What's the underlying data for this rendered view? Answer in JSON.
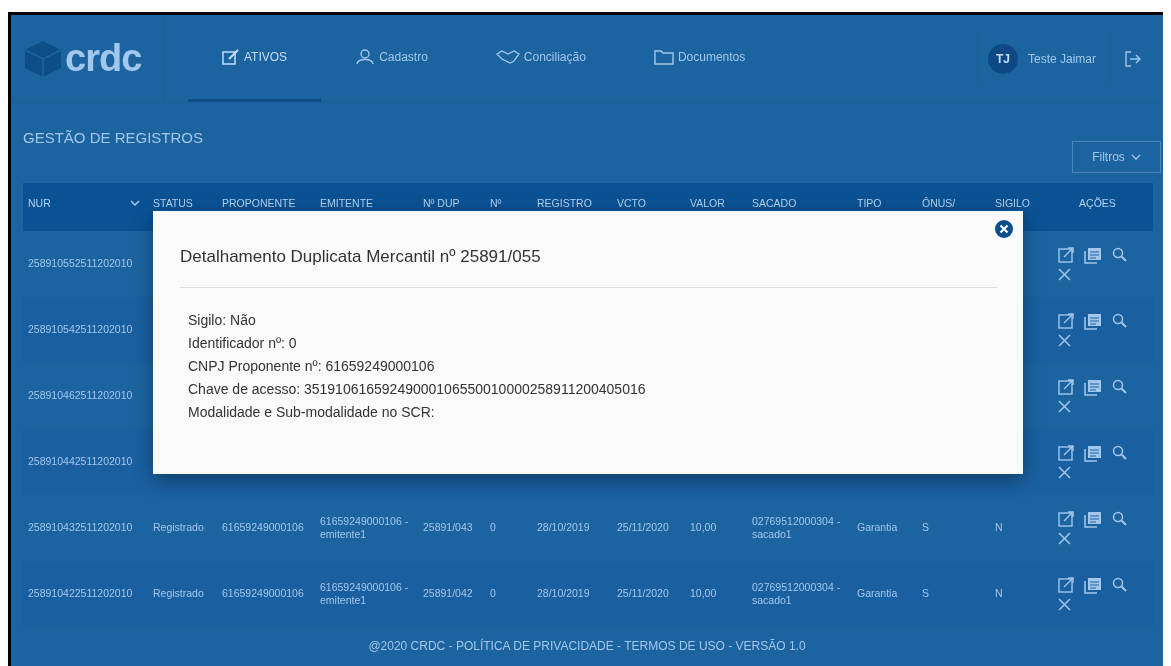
{
  "nav": {
    "logo": "crdc",
    "tabs": [
      {
        "label": "ATIVOS",
        "selected": true
      },
      {
        "label": "Cadastro",
        "selected": false
      },
      {
        "label": "Conciliação",
        "selected": false
      },
      {
        "label": "Documentos",
        "selected": false
      }
    ],
    "user": {
      "initials": "TJ",
      "name": "Teste Jaimar"
    }
  },
  "page": {
    "title": "GESTÃO DE REGISTROS",
    "filter_button": "Filtros"
  },
  "table": {
    "columns": [
      {
        "label": "NUR",
        "sortable": true
      },
      {
        "label": "STATUS",
        "sortable": false
      },
      {
        "label": "PROPONENTE",
        "sortable": false
      },
      {
        "label": "EMITENTE",
        "sortable": false
      },
      {
        "label": "Nº DUP",
        "sortable": false
      },
      {
        "label": "Nº",
        "sortable": false
      },
      {
        "label": "REGISTRO",
        "sortable": false
      },
      {
        "label": "VCTO",
        "sortable": false
      },
      {
        "label": "VALOR",
        "sortable": false
      },
      {
        "label": "SACADO",
        "sortable": false
      },
      {
        "label": "TIPO",
        "sortable": false
      },
      {
        "label": "ÔNUS/",
        "sortable": false
      },
      {
        "label": "SIGILO",
        "sortable": false
      },
      {
        "label": "AÇÕES",
        "sortable": false
      }
    ],
    "rows": [
      {
        "cells": [
          "258910552511202010"
        ]
      },
      {
        "cells": [
          "258910542511202010"
        ]
      },
      {
        "cells": [
          "258910462511202010"
        ]
      },
      {
        "cells": [
          "258910442511202010"
        ]
      },
      {
        "cells": [
          "258910432511202010",
          "Registrado",
          "61659249000106",
          "61659249000106 - emitente1",
          "25891/043",
          "0",
          "28/10/2019",
          "25/11/2020",
          "10,00",
          "02769512000304 - sacado1",
          "Garantia",
          "S",
          "N"
        ]
      },
      {
        "cells": [
          "258910422511202010",
          "Registrado",
          "61659249000106",
          "61659249000106 - emitente1",
          "25891/042",
          "0",
          "28/10/2019",
          "25/11/2020",
          "10,00",
          "02769512000304 - sacado1",
          "Garantia",
          "S",
          "N"
        ]
      }
    ]
  },
  "modal": {
    "title": "Detalhamento Duplicata Mercantil nº 25891/055",
    "lines": [
      "Sigilo: Não",
      "Identificador nº: 0",
      "CNPJ Proponente nº: 61659249000106",
      "Chave de acesso: 35191061659249000106550010000258911200405016",
      "Modalidade e Sub-modalidade no SCR:"
    ]
  },
  "footer": "@2020 CRDC - POLÍTICA DE PRIVACIDADE - TERMOS DE USO - VERSÃO 1.0"
}
